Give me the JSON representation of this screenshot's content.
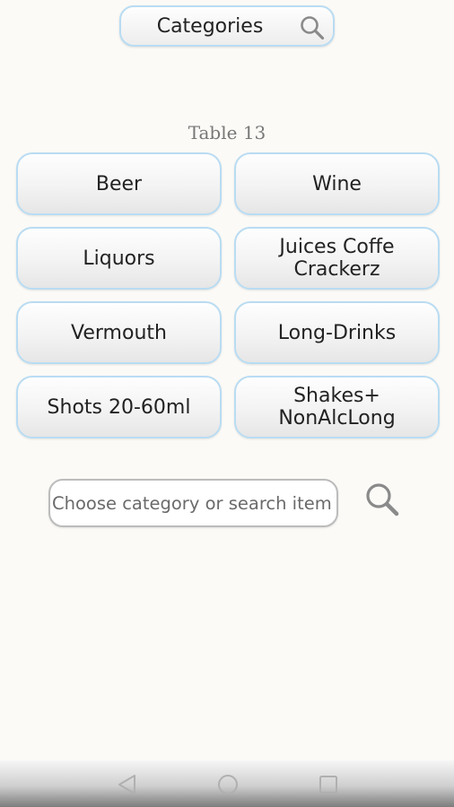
{
  "header": {
    "categories_label": "Categories",
    "search_icon": "search-icon"
  },
  "table_title": "Table 13",
  "categories": [
    {
      "label": "Beer"
    },
    {
      "label": "Wine"
    },
    {
      "label": "Liquors"
    },
    {
      "label": "Juices Coffe\nCrackerz"
    },
    {
      "label": "Vermouth"
    },
    {
      "label": "Long-Drinks"
    },
    {
      "label": "Shots 20-60ml"
    },
    {
      "label": "Shakes+\nNonAlcLong"
    }
  ],
  "search": {
    "placeholder": "Choose category or search item",
    "value": "",
    "button_icon": "search-icon"
  },
  "nav": {
    "back_icon": "back-triangle-icon",
    "home_icon": "home-circle-icon",
    "recents_icon": "recents-square-icon"
  },
  "colors": {
    "background": "#fbfaf7",
    "button_border": "#b9dcf2",
    "title_text": "#777777"
  }
}
